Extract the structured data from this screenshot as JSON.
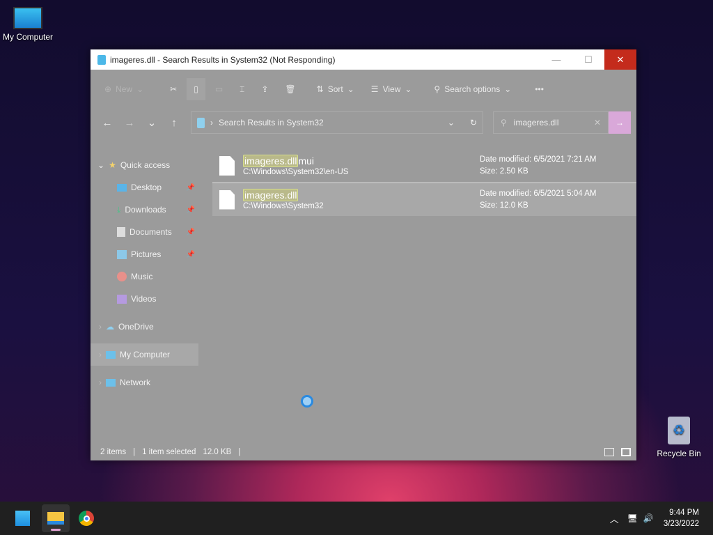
{
  "desktop": {
    "my_computer": "My Computer",
    "recycle_bin": "Recycle Bin"
  },
  "window": {
    "title": "imageres.dll - Search Results in System32 (Not Responding)"
  },
  "toolbar": {
    "new": "New",
    "sort": "Sort",
    "view": "View",
    "search_options": "Search options",
    "more": "•••"
  },
  "address": {
    "path": "Search Results in System32",
    "search_value": "imageres.dll"
  },
  "sidebar": {
    "items": [
      {
        "label": "Quick access",
        "pinned": false
      },
      {
        "label": "Desktop",
        "pinned": true
      },
      {
        "label": "Downloads",
        "pinned": true
      },
      {
        "label": "Documents",
        "pinned": true
      },
      {
        "label": "Pictures",
        "pinned": true
      },
      {
        "label": "Music",
        "pinned": false
      },
      {
        "label": "Videos",
        "pinned": false
      },
      {
        "label": "OneDrive",
        "pinned": false
      },
      {
        "label": "My Computer",
        "pinned": false
      },
      {
        "label": "Network",
        "pinned": false
      }
    ]
  },
  "files": [
    {
      "match": "imageres.dll",
      "rest": "mui",
      "path": "C:\\Windows\\System32\\en-US",
      "date": "Date modified: 6/5/2021 7:21 AM",
      "size": "Size: 2.50 KB"
    },
    {
      "match": "imageres.dll",
      "rest": "",
      "path": "C:\\Windows\\System32",
      "date": "Date modified: 6/5/2021 5:04 AM",
      "size": "Size: 12.0 KB"
    }
  ],
  "status": {
    "count": "2 items",
    "selected": "1 item selected",
    "size": "12.0 KB"
  },
  "clock": {
    "time": "9:44 PM",
    "date": "3/23/2022"
  }
}
